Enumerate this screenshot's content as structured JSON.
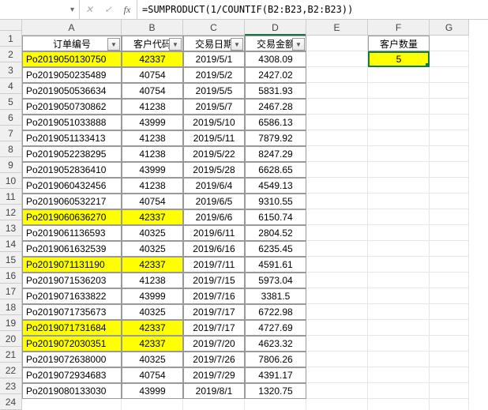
{
  "formula_bar": {
    "name_box": "",
    "fx_label": "fx",
    "formula": "=SUMPRODUCT(1/COUNTIF(B2:B23,B2:B23))"
  },
  "columns": [
    "A",
    "B",
    "C",
    "D",
    "E",
    "F",
    "G"
  ],
  "selected_col": "D",
  "row_numbers": [
    "1",
    "2",
    "3",
    "4",
    "5",
    "6",
    "7",
    "8",
    "9",
    "10",
    "11",
    "12",
    "13",
    "14",
    "15",
    "16",
    "17",
    "18",
    "19",
    "20",
    "21",
    "22",
    "23",
    "24"
  ],
  "headers": {
    "A": "订单编号",
    "B": "客户代码",
    "C": "交易日期",
    "D": "交易金额"
  },
  "side_header": "客户数量",
  "side_value": "5",
  "rows": [
    {
      "a": "Po2019050130750",
      "b": "42337",
      "c": "2019/5/1",
      "d": "4308.09",
      "hl": true
    },
    {
      "a": "Po2019050235489",
      "b": "40754",
      "c": "2019/5/2",
      "d": "2427.02",
      "hl": false
    },
    {
      "a": "Po2019050536634",
      "b": "40754",
      "c": "2019/5/5",
      "d": "5831.93",
      "hl": false
    },
    {
      "a": "Po2019050730862",
      "b": "41238",
      "c": "2019/5/7",
      "d": "2467.28",
      "hl": false
    },
    {
      "a": "Po2019051033888",
      "b": "43999",
      "c": "2019/5/10",
      "d": "6586.13",
      "hl": false
    },
    {
      "a": "Po2019051133413",
      "b": "41238",
      "c": "2019/5/11",
      "d": "7879.92",
      "hl": false
    },
    {
      "a": "Po2019052238295",
      "b": "41238",
      "c": "2019/5/22",
      "d": "8247.29",
      "hl": false
    },
    {
      "a": "Po2019052836410",
      "b": "43999",
      "c": "2019/5/28",
      "d": "6628.65",
      "hl": false
    },
    {
      "a": "Po2019060432456",
      "b": "41238",
      "c": "2019/6/4",
      "d": "4549.13",
      "hl": false
    },
    {
      "a": "Po2019060532217",
      "b": "40754",
      "c": "2019/6/5",
      "d": "9310.55",
      "hl": false
    },
    {
      "a": "Po2019060636270",
      "b": "42337",
      "c": "2019/6/6",
      "d": "6150.74",
      "hl": true
    },
    {
      "a": "Po2019061136593",
      "b": "40325",
      "c": "2019/6/11",
      "d": "2804.52",
      "hl": false
    },
    {
      "a": "Po2019061632539",
      "b": "40325",
      "c": "2019/6/16",
      "d": "6235.45",
      "hl": false
    },
    {
      "a": "Po2019071131190",
      "b": "42337",
      "c": "2019/7/11",
      "d": "4591.61",
      "hl": true
    },
    {
      "a": "Po2019071536203",
      "b": "41238",
      "c": "2019/7/15",
      "d": "5973.04",
      "hl": false
    },
    {
      "a": "Po2019071633822",
      "b": "43999",
      "c": "2019/7/16",
      "d": "3381.5",
      "hl": false
    },
    {
      "a": "Po2019071735673",
      "b": "40325",
      "c": "2019/7/17",
      "d": "6722.98",
      "hl": false
    },
    {
      "a": "Po2019071731684",
      "b": "42337",
      "c": "2019/7/17",
      "d": "4727.69",
      "hl": true
    },
    {
      "a": "Po2019072030351",
      "b": "42337",
      "c": "2019/7/20",
      "d": "4623.32",
      "hl": true
    },
    {
      "a": "Po2019072638000",
      "b": "40325",
      "c": "2019/7/26",
      "d": "7806.26",
      "hl": false
    },
    {
      "a": "Po2019072934683",
      "b": "40754",
      "c": "2019/7/29",
      "d": "4391.17",
      "hl": false
    },
    {
      "a": "Po2019080133030",
      "b": "43999",
      "c": "2019/8/1",
      "d": "1320.75",
      "hl": false
    }
  ],
  "icons": {
    "dropdown": "▾",
    "cancel": "✕",
    "check": "✓",
    "filter": "▼"
  }
}
